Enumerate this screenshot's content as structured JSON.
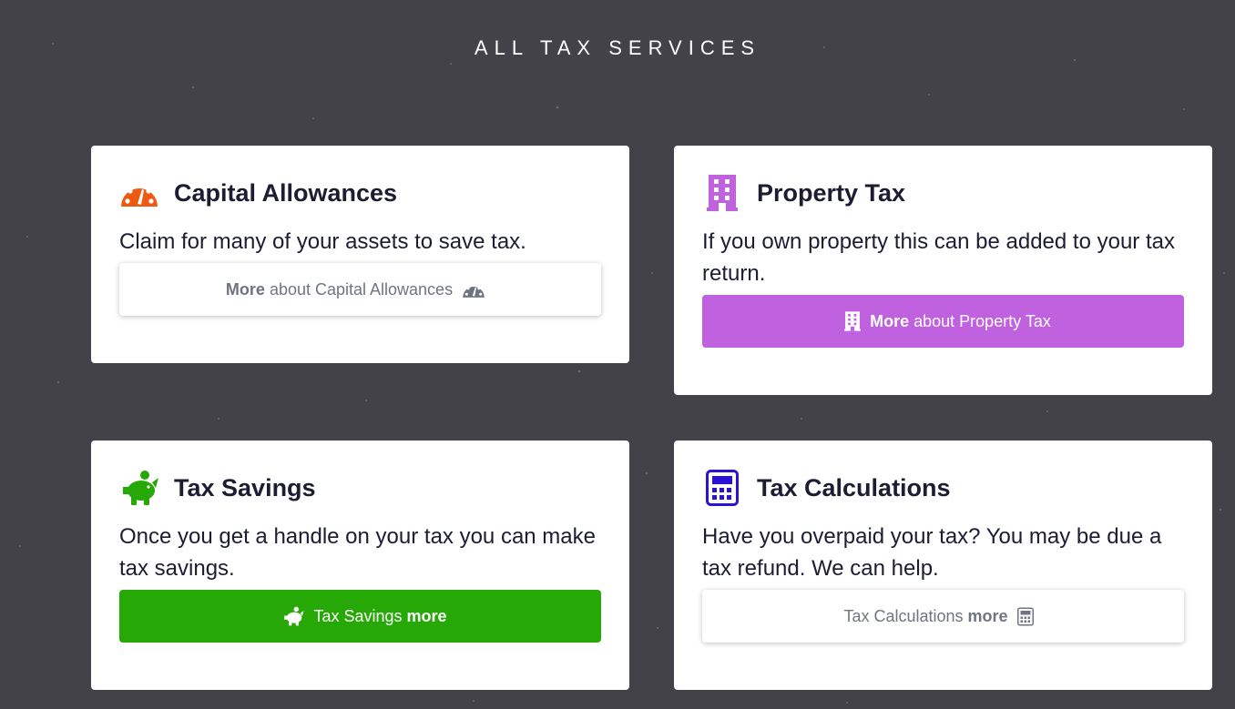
{
  "section": {
    "title": "ALL TAX SERVICES"
  },
  "cards": {
    "capital": {
      "icon": "tachometer-icon",
      "title": "Capital Allowances",
      "text": "Claim for many of your assets to save tax.",
      "button": {
        "prefix": "More",
        "text": "about Capital Allowances",
        "icon": "tachometer-icon"
      },
      "accent": "#ee5a12"
    },
    "property": {
      "icon": "building-icon",
      "title": "Property Tax",
      "text": "If you own property this can be added to your tax return.",
      "button": {
        "prefix": "More",
        "text": "about Property Tax",
        "icon": "building-icon"
      },
      "accent": "#c061e0"
    },
    "savings": {
      "icon": "piggy-bank-icon",
      "title": "Tax Savings",
      "text": "Once you get a handle on your tax you can make tax savings.",
      "button": {
        "text": "Tax Savings",
        "suffix": "more",
        "icon": "piggy-bank-icon"
      },
      "accent": "#26a806"
    },
    "calculations": {
      "icon": "calculator-icon",
      "title": "Tax Calculations",
      "text": "Have you overpaid your tax? You may be due a tax refund. We can help.",
      "button": {
        "text": "Tax Calculations",
        "suffix": "more",
        "icon": "calculator-icon"
      },
      "accent": "#2b13d6"
    }
  },
  "colors": {
    "background": "#434248",
    "card": "#ffffff",
    "text": "#1c1d33",
    "muted": "#6f7580"
  }
}
